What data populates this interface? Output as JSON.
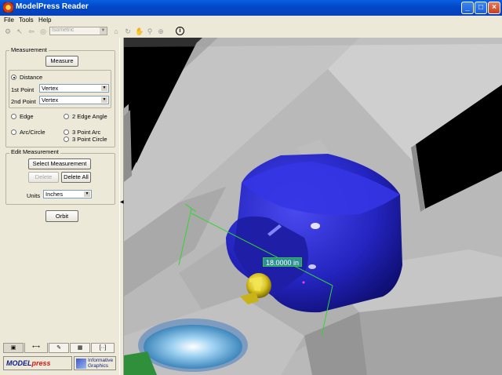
{
  "window": {
    "title": "ModelPress Reader"
  },
  "menu": {
    "items": [
      "File",
      "Tools",
      "Help"
    ]
  },
  "toolbar": {
    "view_select": "Isometric"
  },
  "measurement": {
    "group_title": "Measurement",
    "measure_button": "Measure",
    "distance_label": "Distance",
    "first_point_label": "1st Point",
    "first_point_value": "Vertex",
    "second_point_label": "2nd Point",
    "second_point_value": "Vertex",
    "edge_label": "Edge",
    "edge_angle_label": "2 Edge Angle",
    "arc_circle_label": "Arc/Circle",
    "three_point_arc_label": "3 Point Arc",
    "three_point_circle_label": "3 Point Circle"
  },
  "edit_measurement": {
    "group_title": "Edit Measurement",
    "select_button": "Select Measurement",
    "delete_button": "Delete",
    "delete_all_button": "Delete All",
    "units_label": "Units",
    "units_value": "Inches"
  },
  "orbit_button": "Orbit",
  "bottom_tabs": [
    "image-icon",
    "measure-icon",
    "markup-icon",
    "grid-icon",
    "explode-icon"
  ],
  "logos": {
    "modelpress_a": "MODEL",
    "modelpress_b": "press",
    "ig_line1": "Informative",
    "ig_line2": "Graphics"
  },
  "viewport": {
    "dimension_label": "18.0000 in"
  },
  "colors": {
    "titlebar": "#0a5fe0",
    "panel": "#ece9d8",
    "model_blue": "#2a2ac8",
    "dimension_green": "#31c631"
  }
}
